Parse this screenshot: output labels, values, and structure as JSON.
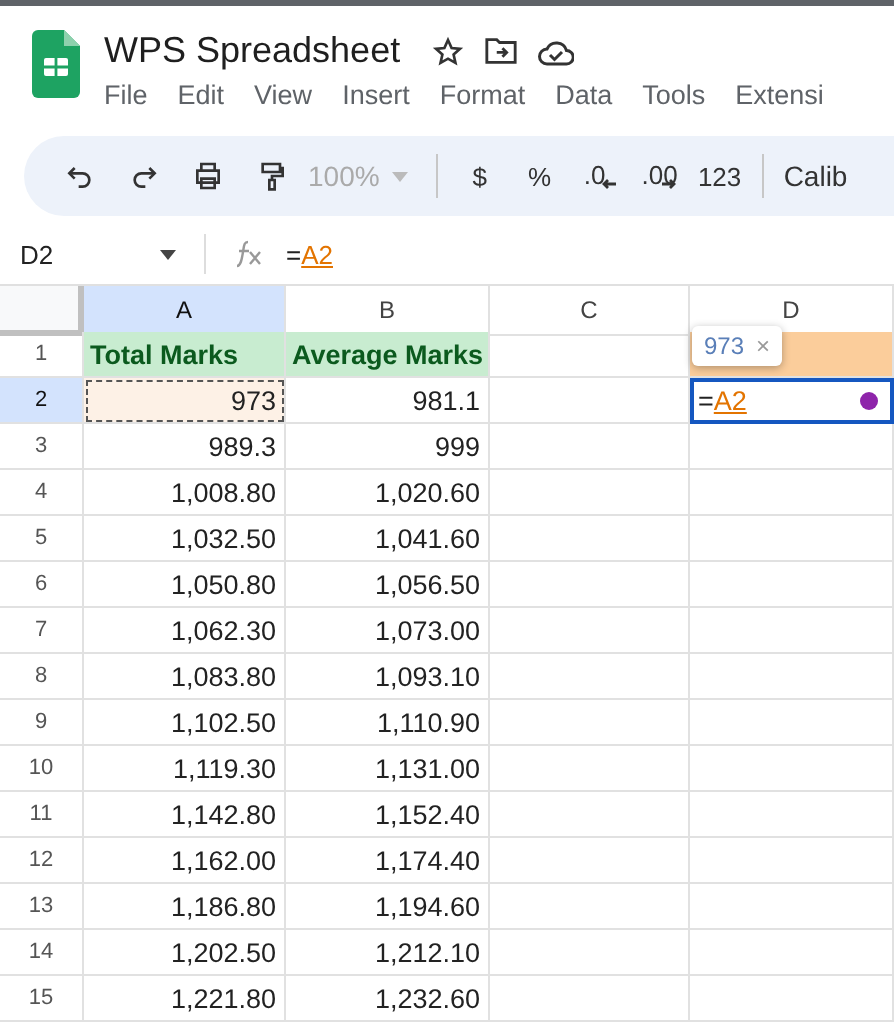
{
  "app": {
    "title": "WPS Spreadsheet",
    "menu": [
      "File",
      "Edit",
      "View",
      "Insert",
      "Format",
      "Data",
      "Tools",
      "Extensi"
    ]
  },
  "toolbar": {
    "zoom": "100%",
    "items": [
      {
        "kind": "text",
        "label": "$"
      },
      {
        "kind": "text",
        "label": "%"
      },
      {
        "kind": "decrease",
        "label": ".0"
      },
      {
        "kind": "increase",
        "label": ".00"
      },
      {
        "kind": "text",
        "label": "123"
      }
    ],
    "font": "Calib"
  },
  "formula_bar": {
    "cell_ref": "D2",
    "prefix": "=",
    "reference": "A2"
  },
  "columns": [
    {
      "label": "A",
      "selected": true
    },
    {
      "label": "B",
      "selected": false
    },
    {
      "label": "C",
      "selected": false
    },
    {
      "label": "D",
      "selected": false
    }
  ],
  "rows": [
    {
      "number": "1",
      "selected": false,
      "cells": [
        {
          "kind": "header",
          "text": "Total Marks"
        },
        {
          "kind": "header",
          "text": "Average Marks"
        },
        {
          "kind": "empty"
        },
        {
          "kind": "highlight"
        }
      ]
    },
    {
      "number": "2",
      "selected": true,
      "cells": [
        {
          "kind": "referenced",
          "text": "973"
        },
        {
          "kind": "value",
          "text": "981.1"
        },
        {
          "kind": "empty"
        },
        {
          "kind": "editing",
          "prefix": "=",
          "reference": "A2"
        }
      ]
    },
    {
      "number": "3",
      "selected": false,
      "cells": [
        {
          "kind": "value",
          "text": "989.3"
        },
        {
          "kind": "value",
          "text": "999"
        },
        {
          "kind": "empty"
        },
        {
          "kind": "empty"
        }
      ]
    },
    {
      "number": "4",
      "selected": false,
      "cells": [
        {
          "kind": "value",
          "text": "1,008.80"
        },
        {
          "kind": "value",
          "text": "1,020.60"
        },
        {
          "kind": "empty"
        },
        {
          "kind": "empty"
        }
      ]
    },
    {
      "number": "5",
      "selected": false,
      "cells": [
        {
          "kind": "value",
          "text": "1,032.50"
        },
        {
          "kind": "value",
          "text": "1,041.60"
        },
        {
          "kind": "empty"
        },
        {
          "kind": "empty"
        }
      ]
    },
    {
      "number": "6",
      "selected": false,
      "cells": [
        {
          "kind": "value",
          "text": "1,050.80"
        },
        {
          "kind": "value",
          "text": "1,056.50"
        },
        {
          "kind": "empty"
        },
        {
          "kind": "empty"
        }
      ]
    },
    {
      "number": "7",
      "selected": false,
      "cells": [
        {
          "kind": "value",
          "text": "1,062.30"
        },
        {
          "kind": "value",
          "text": "1,073.00"
        },
        {
          "kind": "empty"
        },
        {
          "kind": "empty"
        }
      ]
    },
    {
      "number": "8",
      "selected": false,
      "cells": [
        {
          "kind": "value",
          "text": "1,083.80"
        },
        {
          "kind": "value",
          "text": "1,093.10"
        },
        {
          "kind": "empty"
        },
        {
          "kind": "empty"
        }
      ]
    },
    {
      "number": "9",
      "selected": false,
      "cells": [
        {
          "kind": "value",
          "text": "1,102.50"
        },
        {
          "kind": "value",
          "text": "1,110.90"
        },
        {
          "kind": "empty"
        },
        {
          "kind": "empty"
        }
      ]
    },
    {
      "number": "10",
      "selected": false,
      "cells": [
        {
          "kind": "value",
          "text": "1,119.30"
        },
        {
          "kind": "value",
          "text": "1,131.00"
        },
        {
          "kind": "empty"
        },
        {
          "kind": "empty"
        }
      ]
    },
    {
      "number": "11",
      "selected": false,
      "cells": [
        {
          "kind": "value",
          "text": "1,142.80"
        },
        {
          "kind": "value",
          "text": "1,152.40"
        },
        {
          "kind": "empty"
        },
        {
          "kind": "empty"
        }
      ]
    },
    {
      "number": "12",
      "selected": false,
      "cells": [
        {
          "kind": "value",
          "text": "1,162.00"
        },
        {
          "kind": "value",
          "text": "1,174.40"
        },
        {
          "kind": "empty"
        },
        {
          "kind": "empty"
        }
      ]
    },
    {
      "number": "13",
      "selected": false,
      "cells": [
        {
          "kind": "value",
          "text": "1,186.80"
        },
        {
          "kind": "value",
          "text": "1,194.60"
        },
        {
          "kind": "empty"
        },
        {
          "kind": "empty"
        }
      ]
    },
    {
      "number": "14",
      "selected": false,
      "cells": [
        {
          "kind": "value",
          "text": "1,202.50"
        },
        {
          "kind": "value",
          "text": "1,212.10"
        },
        {
          "kind": "empty"
        },
        {
          "kind": "empty"
        }
      ]
    },
    {
      "number": "15",
      "selected": false,
      "cells": [
        {
          "kind": "value",
          "text": "1,221.80"
        },
        {
          "kind": "value",
          "text": "1,232.60"
        },
        {
          "kind": "empty"
        },
        {
          "kind": "empty"
        }
      ]
    }
  ],
  "reference_tooltip": {
    "value": "973",
    "close": "×"
  }
}
